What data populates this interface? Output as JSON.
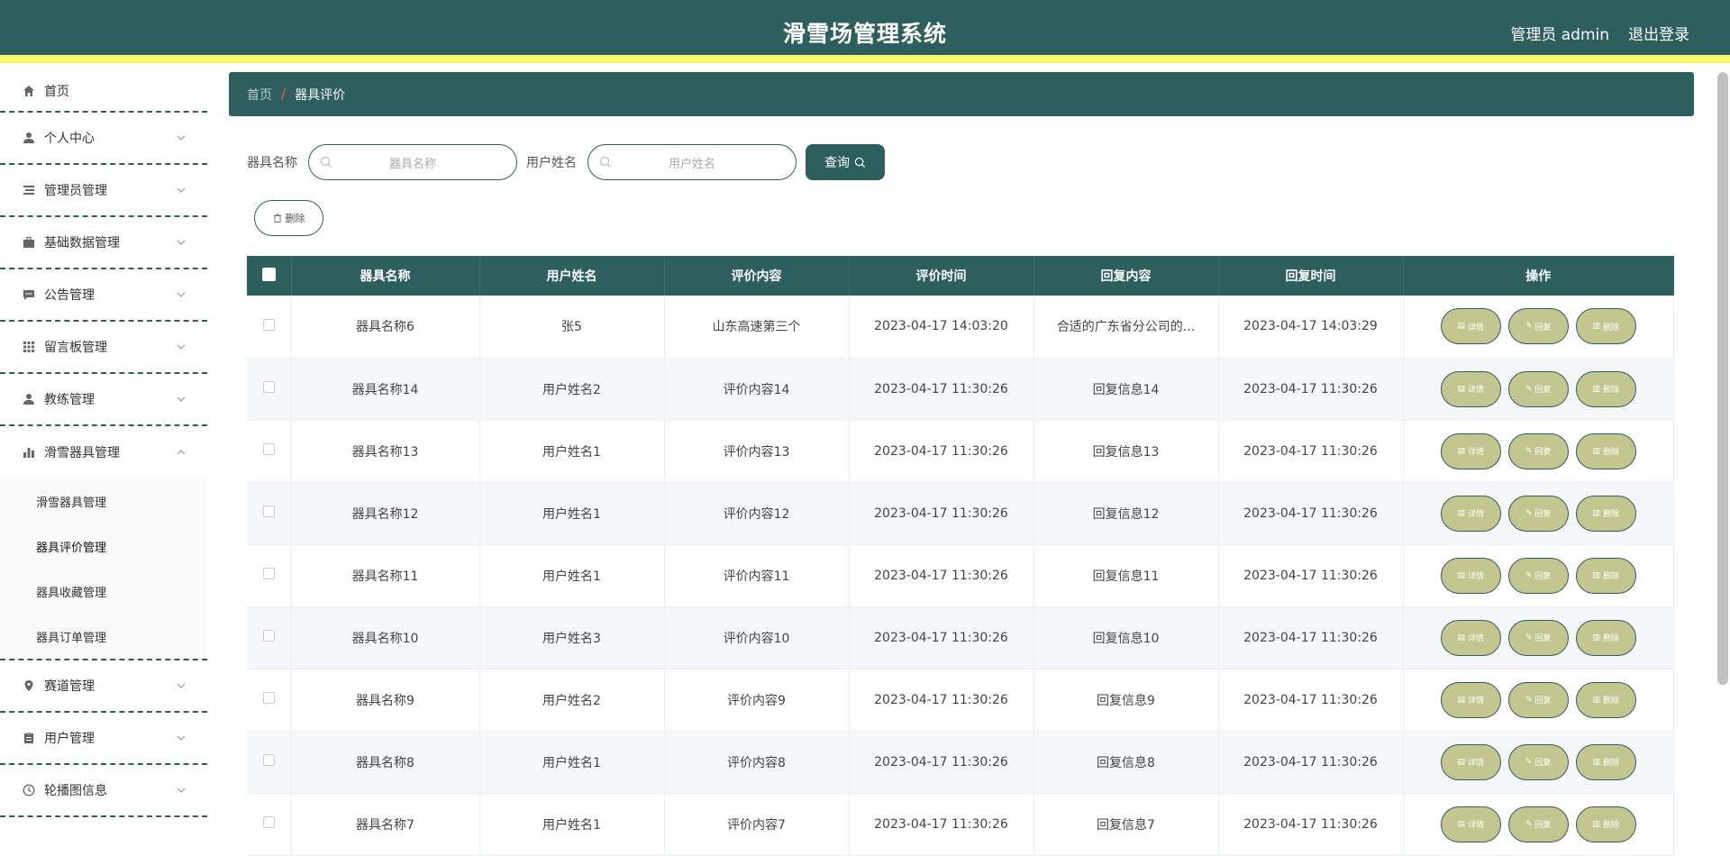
{
  "header": {
    "title": "滑雪场管理系统",
    "user": "管理员 admin",
    "logout": "退出登录"
  },
  "sidebar": {
    "items": [
      {
        "label": "首页",
        "icon": "home-icon"
      },
      {
        "label": "个人中心",
        "icon": "user-icon"
      },
      {
        "label": "管理员管理",
        "icon": "list-icon"
      },
      {
        "label": "基础数据管理",
        "icon": "briefcase-icon"
      },
      {
        "label": "公告管理",
        "icon": "message-icon"
      },
      {
        "label": "留言板管理",
        "icon": "grid-icon"
      },
      {
        "label": "教练管理",
        "icon": "user-icon"
      },
      {
        "label": "滑雪器具管理",
        "icon": "chart-icon"
      },
      {
        "label": "赛道管理",
        "icon": "location-icon"
      },
      {
        "label": "用户管理",
        "icon": "clipboard-icon"
      },
      {
        "label": "轮播图信息",
        "icon": "clock-icon"
      }
    ],
    "submenu": [
      "滑雪器具管理",
      "器具评价管理",
      "器具收藏管理",
      "器具订单管理"
    ]
  },
  "breadcrumb": {
    "home": "首页",
    "separator": "/",
    "current": "器具评价"
  },
  "search": {
    "field1_label": "器具名称",
    "field1_placeholder": "器具名称",
    "field2_label": "用户姓名",
    "field2_placeholder": "用户姓名",
    "query_button": "查询"
  },
  "delete_button": "删除",
  "table": {
    "headers": [
      "器具名称",
      "用户姓名",
      "评价内容",
      "评价时间",
      "回复内容",
      "回复时间",
      "操作"
    ],
    "ops": [
      "详情",
      "回复",
      "删除"
    ],
    "rows": [
      [
        "器具名称6",
        "张5",
        "山东高速第三个",
        "2023-04-17 14:03:20",
        "合适的广东省分公司的...",
        "2023-04-17 14:03:29"
      ],
      [
        "器具名称14",
        "用户姓名2",
        "评价内容14",
        "2023-04-17 11:30:26",
        "回复信息14",
        "2023-04-17 11:30:26"
      ],
      [
        "器具名称13",
        "用户姓名1",
        "评价内容13",
        "2023-04-17 11:30:26",
        "回复信息13",
        "2023-04-17 11:30:26"
      ],
      [
        "器具名称12",
        "用户姓名1",
        "评价内容12",
        "2023-04-17 11:30:26",
        "回复信息12",
        "2023-04-17 11:30:26"
      ],
      [
        "器具名称11",
        "用户姓名1",
        "评价内容11",
        "2023-04-17 11:30:26",
        "回复信息11",
        "2023-04-17 11:30:26"
      ],
      [
        "器具名称10",
        "用户姓名3",
        "评价内容10",
        "2023-04-17 11:30:26",
        "回复信息10",
        "2023-04-17 11:30:26"
      ],
      [
        "器具名称9",
        "用户姓名2",
        "评价内容9",
        "2023-04-17 11:30:26",
        "回复信息9",
        "2023-04-17 11:30:26"
      ],
      [
        "器具名称8",
        "用户姓名1",
        "评价内容8",
        "2023-04-17 11:30:26",
        "回复信息8",
        "2023-04-17 11:30:26"
      ],
      [
        "器具名称7",
        "用户姓名1",
        "评价内容7",
        "2023-04-17 11:30:26",
        "回复信息7",
        "2023-04-17 11:30:26"
      ]
    ]
  },
  "colors": {
    "primary": "#2c5f5d",
    "accent_stripe": "#f8f86a",
    "op_button": "#c3c68e"
  }
}
